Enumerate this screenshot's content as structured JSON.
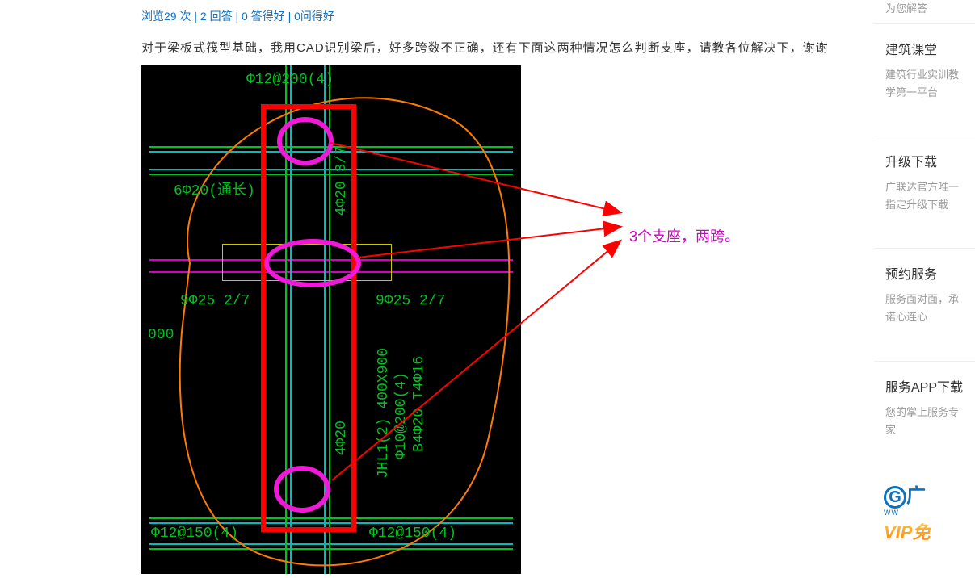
{
  "meta": {
    "views_label": "浏览29 次",
    "sep": " | ",
    "answers": "2 回答",
    "good_answers": "0 答得好",
    "good_questions": "0问得好"
  },
  "description": "对于梁板式筏型基础，我用CAD识别梁后，好多跨数不正确，还有下面这两种情况怎么判断支座，请教各位解决下，谢谢",
  "annotation": "3个支座，两跨。",
  "cad_text": {
    "top_dim": "Φ12@200(4)",
    "left_beam": "6Φ20(通长)",
    "mid_spec_right": "4Φ20 3/7",
    "left_bot": "9Φ25 2/7",
    "right_bot": "9Φ25 2/7",
    "frag_000": "000",
    "vlabel_jhl": "JHL1(2) 400X900",
    "vlabel_phi": "Φ10@200(4)",
    "vlabel_b4": "B4Φ20 T4Φ16",
    "vlabel_4phi20": "4Φ20",
    "bot_left": "Φ12@150(4)",
    "bot_right": "Φ12@150(4)"
  },
  "sidebar": {
    "top_trunc": "为您解答",
    "cards": [
      {
        "title": "建筑课堂",
        "desc": "建筑行业实训教学第一平台"
      },
      {
        "title": "升级下载",
        "desc": "广联达官方唯一指定升级下载"
      },
      {
        "title": "预约服务",
        "desc": "服务面对面，承诺心连心"
      },
      {
        "title": "服务APP下载",
        "desc": "您的掌上服务专家"
      }
    ],
    "promo_g": "G",
    "promo_brand": "广",
    "promo_sub": "WW",
    "promo_vip": "VIP免"
  }
}
